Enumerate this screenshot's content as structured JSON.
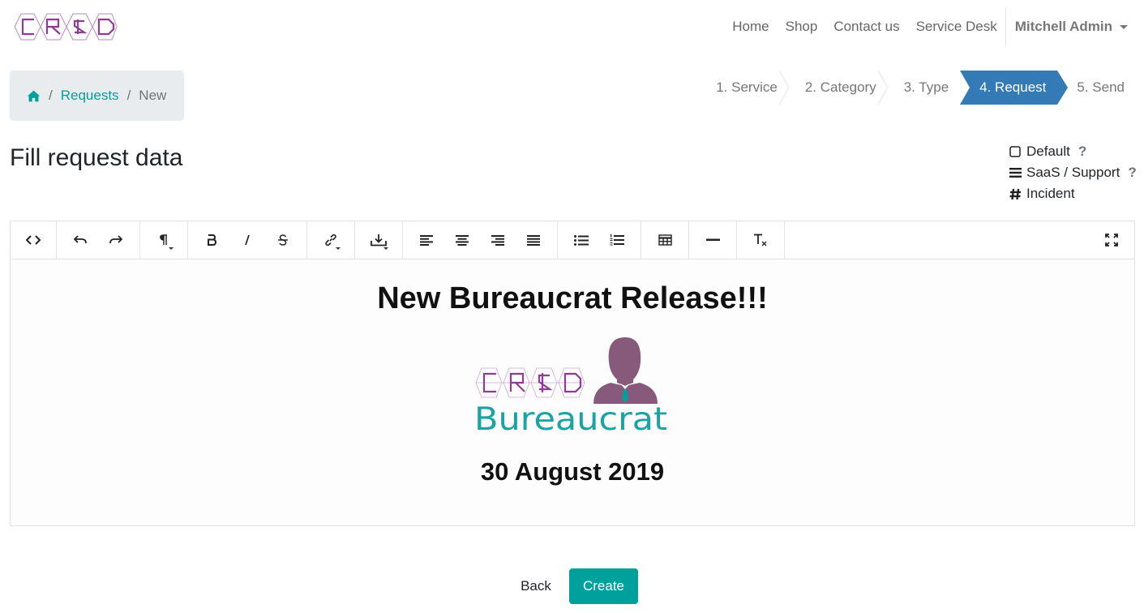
{
  "brand": {
    "logo_text": "CR&D"
  },
  "nav": {
    "links": [
      "Home",
      "Shop",
      "Contact us",
      "Service Desk"
    ],
    "user": "Mitchell Admin"
  },
  "breadcrumb": {
    "items": [
      "Requests",
      "New"
    ],
    "separator": "/"
  },
  "steps": {
    "items": [
      "1. Service",
      "2. Category",
      "3. Type",
      "4. Request",
      "5. Send"
    ],
    "active_index": 3
  },
  "page": {
    "title": "Fill request data"
  },
  "options": {
    "items": [
      {
        "icon": "square-icon",
        "label": "Default",
        "help": "?"
      },
      {
        "icon": "bars-icon",
        "label": "SaaS / Support",
        "help": "?"
      },
      {
        "icon": "hashtag-icon",
        "label": "Incident",
        "help": ""
      }
    ]
  },
  "editor": {
    "heading": "New Bureaucrat Release!!!",
    "image": {
      "logo_text": "CR&D",
      "product": "Bureaucrat"
    },
    "date": "30 August 2019"
  },
  "actions": {
    "back": "Back",
    "create": "Create"
  },
  "colors": {
    "accent": "#00a09d",
    "step_active": "#337ab7",
    "logo_purple": "#8e3c95",
    "avatar": "#875a7b"
  }
}
